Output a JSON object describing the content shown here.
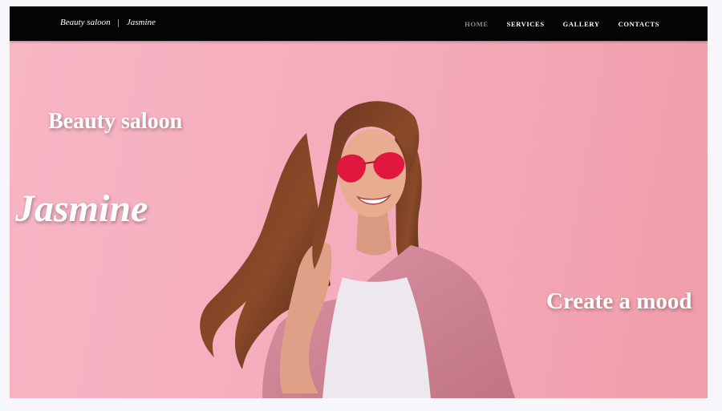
{
  "header": {
    "brand_left": "Beauty saloon",
    "brand_separator": "|",
    "brand_right": "Jasmine",
    "nav": [
      {
        "label": "HOME",
        "active": true
      },
      {
        "label": "SERVICES",
        "active": false
      },
      {
        "label": "GALLERY",
        "active": false
      },
      {
        "label": "CONTACTS",
        "active": false
      }
    ]
  },
  "hero": {
    "subtitle": "Beauty saloon",
    "title": "Jasmine",
    "tagline": "Create a mood",
    "image_subject": "woman-in-pink-sunglasses-photo"
  },
  "colors": {
    "navbar_bg": "#040404",
    "hero_bg": "#f5adbd",
    "nav_active": "#8e8e8e",
    "text": "#ffffff"
  }
}
